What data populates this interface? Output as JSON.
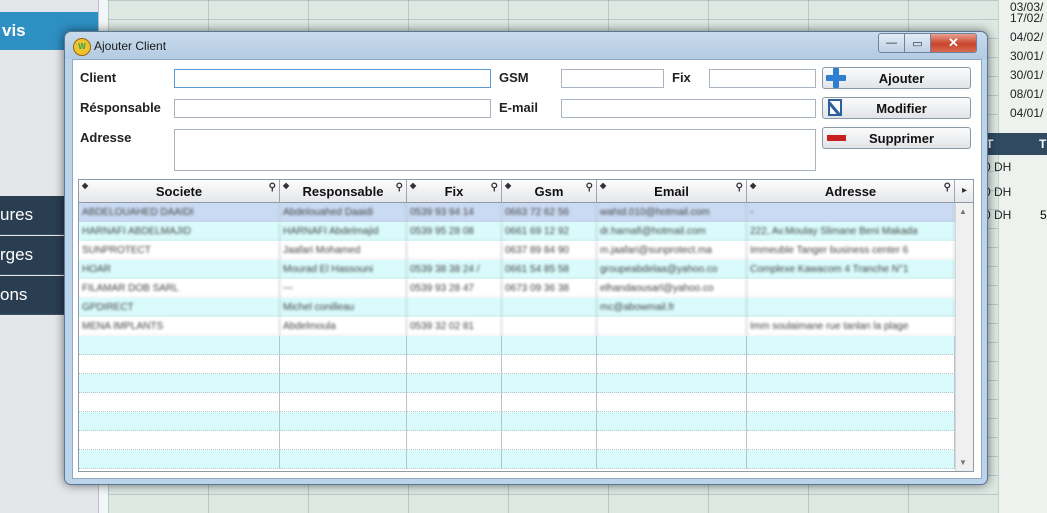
{
  "background": {
    "sidebar": {
      "active_item": "vis",
      "items": [
        "ures",
        "rges",
        "ons"
      ]
    },
    "right_dates": [
      "03/03/",
      "17/02/",
      "04/02/",
      "30/01/",
      "30/01/",
      "08/01/",
      "04/01/"
    ],
    "right_header": [
      "T",
      "T"
    ],
    "right_values": [
      "0 DH",
      "0 DH",
      "0 DH"
    ],
    "right_extra": "5"
  },
  "dialog": {
    "title": "Ajouter Client",
    "window_buttons": {
      "minimize": "—",
      "maximize": "▭",
      "close": "✕"
    },
    "form": {
      "client_label": "Client",
      "client_value": "",
      "gsm_label": "GSM",
      "gsm_value": "",
      "fix_label": "Fix",
      "fix_value": "",
      "responsable_label": "Résponsable",
      "responsable_value": "",
      "email_label": "E-mail",
      "email_value": "",
      "adresse_label": "Adresse",
      "adresse_value": ""
    },
    "buttons": {
      "ajouter": "Ajouter",
      "modifier": "Modifier",
      "supprimer": "Supprimer"
    },
    "grid": {
      "columns": [
        "Societe",
        "Responsable",
        "Fix",
        "Gsm",
        "Email",
        "Adresse"
      ],
      "rows": [
        [
          "ABDELOUAHED DAAIDI",
          "Abdelouahed Daaidi",
          "0539 93 94 14",
          "0663 72 62 56",
          "wahid.010@hotmail.com",
          "-"
        ],
        [
          "HARNAFI ABDELMAJID",
          "HARNAFI Abdelmajid",
          "0539 95 28 08",
          "0661 69 12 92",
          "dr.harnafi@hotmail.com",
          "222, Av.Moulay Slimane Beni Makada"
        ],
        [
          "SUNPROTECT",
          "Jaafari Mohamed",
          "",
          "0637 89 84 90",
          "m.jaafari@sunprotect.ma",
          "Immeuble Tanger business center 6"
        ],
        [
          "HOAR",
          "Mourad El Hassouni",
          "0539 38 38 24 /",
          "0661 54 85 58",
          "groupeabdelaa@yahoo.co",
          "Complexe Kawacom 4 Tranche N°1"
        ],
        [
          "FILAMAR DOB SARL",
          "---",
          "0539 93 28 47",
          "0673 09 36 38",
          "elhandaousarl@yahoo.co",
          ""
        ],
        [
          "GPDIRECT",
          "Michel conilleau",
          "",
          "",
          "mc@abowmail.fr",
          ""
        ],
        [
          "MENA IMPLANTS",
          "Abdelmoula",
          "0539 32 02 81",
          "",
          "",
          "Imm soulaimane rue tanlan la plage"
        ]
      ],
      "empty_rows": 7
    }
  }
}
